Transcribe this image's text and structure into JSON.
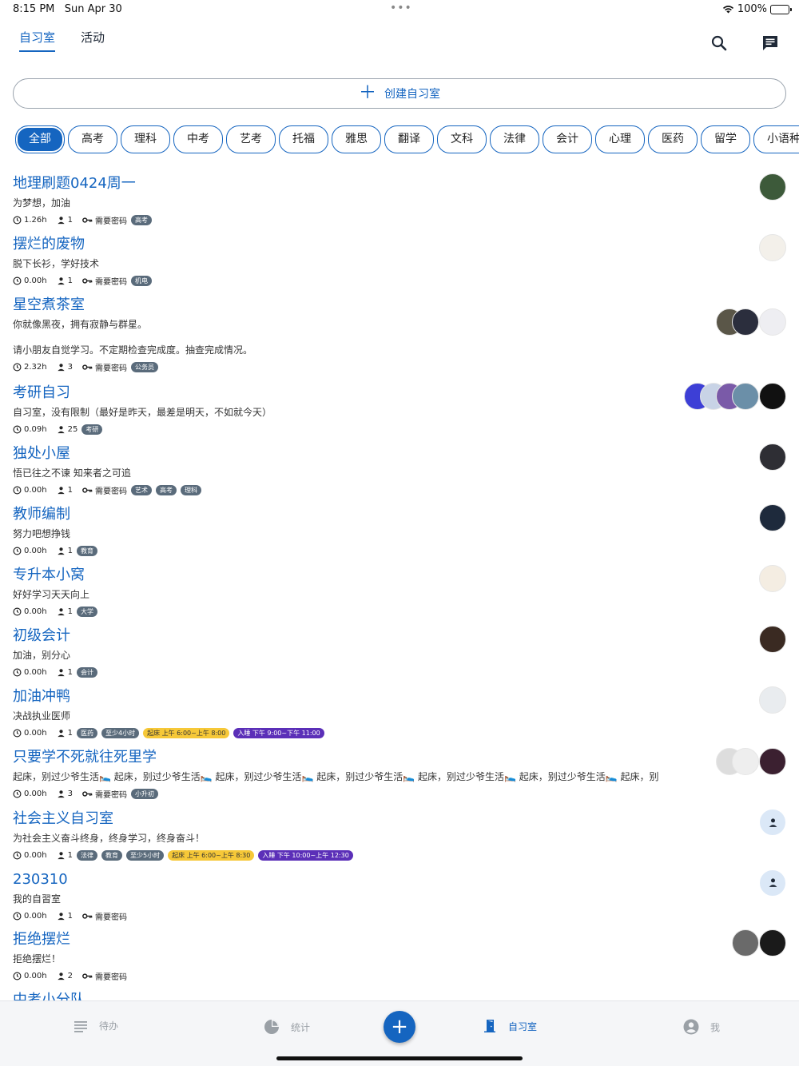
{
  "status": {
    "time": "8:15 PM",
    "date": "Sun Apr 30",
    "battery": "100%",
    "battery_level": 1.0
  },
  "top_tabs": [
    {
      "label": "自习室",
      "active": true
    },
    {
      "label": "活动",
      "active": false
    }
  ],
  "create_button": {
    "label": "创建自习室"
  },
  "categories": [
    "全部",
    "高考",
    "理科",
    "中考",
    "艺考",
    "托福",
    "雅思",
    "翻译",
    "文科",
    "法律",
    "会计",
    "心理",
    "医药",
    "留学",
    "小语种"
  ],
  "active_category": "全部",
  "password_label": "需要密码",
  "colors": {
    "accent": "#1565c0",
    "badge_gray": "#5a6b7b",
    "badge_yellow": "#f6c838",
    "badge_purple": "#5b2fb8"
  },
  "rooms": [
    {
      "name": "地理刷题0424周一",
      "desc": "为梦想，加油",
      "hours": "1.26h",
      "members": "1",
      "password": true,
      "tags": [
        {
          "text": "高考",
          "style": "gray"
        }
      ],
      "avatars": [
        "#3d5a3a"
      ]
    },
    {
      "name": "摆烂的废物",
      "desc": "脱下长衫，学好技术",
      "hours": "0.00h",
      "members": "1",
      "password": true,
      "tags": [
        {
          "text": "机电",
          "style": "gray"
        }
      ],
      "avatars": [
        "#f3f0ea"
      ]
    },
    {
      "name": "星空煮茶室",
      "desc": "你就像黑夜，拥有寂静与群星。",
      "desc2": "请小朋友自觉学习。不定期检查完成度。抽查完成情况。",
      "hours": "2.32h",
      "members": "3",
      "password": true,
      "tags": [
        {
          "text": "公务员",
          "style": "gray"
        }
      ],
      "avatars": [
        "#eeeef2",
        "#2b2e3d",
        "#5a5648"
      ]
    },
    {
      "name": "考研自习",
      "desc": "自习室，没有限制（最好是昨天，最差是明天，不如就今天）",
      "hours": "0.09h",
      "members": "25",
      "password": false,
      "tags": [
        {
          "text": "考研",
          "style": "gray"
        }
      ],
      "avatars": [
        "#111111",
        "#6b8fa8",
        "#7a5aa8",
        "#c8d3e6",
        "#3d3fd6"
      ]
    },
    {
      "name": "独处小屋",
      "desc": "悟已往之不谏 知来者之可追",
      "hours": "0.00h",
      "members": "1",
      "password": true,
      "tags": [
        {
          "text": "艺术",
          "style": "gray"
        },
        {
          "text": "高考",
          "style": "gray"
        },
        {
          "text": "理科",
          "style": "gray"
        }
      ],
      "avatars": [
        "#2e2e34"
      ]
    },
    {
      "name": "教师编制",
      "desc": "努力吧想挣钱",
      "hours": "0.00h",
      "members": "1",
      "password": false,
      "tags": [
        {
          "text": "教育",
          "style": "gray"
        }
      ],
      "avatars": [
        "#1e2a3c"
      ]
    },
    {
      "name": "专升本小窝",
      "desc": "好好学习天天向上",
      "hours": "0.00h",
      "members": "1",
      "password": false,
      "tags": [
        {
          "text": "大学",
          "style": "gray"
        }
      ],
      "avatars": [
        "#f4ede2"
      ]
    },
    {
      "name": "初级会计",
      "desc": "加油，别分心",
      "hours": "0.00h",
      "members": "1",
      "password": false,
      "tags": [
        {
          "text": "会计",
          "style": "gray"
        }
      ],
      "avatars": [
        "#3a2a22"
      ]
    },
    {
      "name": "加油冲鸭",
      "desc": "决战执业医师",
      "hours": "0.00h",
      "members": "1",
      "password": false,
      "tags": [
        {
          "text": "医药",
          "style": "gray"
        },
        {
          "text": "至少4小时",
          "style": "gray"
        },
        {
          "text": "起床 上午 6:00~上午 8:00",
          "style": "yellow"
        },
        {
          "text": "入睡 下午 9:00~下午 11:00",
          "style": "purple"
        }
      ],
      "avatars": [
        "#e9ecef"
      ]
    },
    {
      "name": "只要学不死就往死里学",
      "desc": "起床，别过少爷生活🛌 起床，别过少爷生活🛌 起床，别过少爷生活🛌 起床，别过少爷生活🛌 起床，别过少爷生活🛌 起床，别过少爷生活🛌 起床，别",
      "hours": "0.00h",
      "members": "3",
      "password": true,
      "tags": [
        {
          "text": "小升初",
          "style": "gray"
        }
      ],
      "avatars": [
        "#3b2030",
        "#eeeeee",
        "#dddddd"
      ]
    },
    {
      "name": "社会主义自习室",
      "desc": "为社会主义奋斗终身，终身学习，终身奋斗！",
      "hours": "0.00h",
      "members": "1",
      "password": false,
      "tags": [
        {
          "text": "法律",
          "style": "gray"
        },
        {
          "text": "教育",
          "style": "gray"
        },
        {
          "text": "至少5小时",
          "style": "gray"
        },
        {
          "text": "起床 上午 6:00~上午 8:30",
          "style": "yellow"
        },
        {
          "text": "入睡 下午 10:00~上午 12:30",
          "style": "purple"
        }
      ],
      "avatars": [
        "placeholder"
      ]
    },
    {
      "name": "230310",
      "desc": "我的自習室",
      "hours": "0.00h",
      "members": "1",
      "password": true,
      "tags": [],
      "avatars": [
        "placeholder"
      ]
    },
    {
      "name": "拒绝摆烂",
      "desc": "拒绝摆烂！",
      "hours": "0.00h",
      "members": "2",
      "password": true,
      "tags": [],
      "avatars": [
        "#1a1a1a",
        "#6a6a6a"
      ]
    },
    {
      "name": "中考小分队",
      "desc": "",
      "hours": "",
      "members": "",
      "password": false,
      "tags": [],
      "avatars": []
    }
  ],
  "bottom_nav": [
    {
      "label": "待办",
      "icon": "list-icon",
      "active": false
    },
    {
      "label": "统计",
      "icon": "pie-chart-icon",
      "active": false
    },
    {
      "label": "自习室",
      "icon": "door-icon",
      "active": true
    },
    {
      "label": "我",
      "icon": "account-icon",
      "active": false
    }
  ]
}
